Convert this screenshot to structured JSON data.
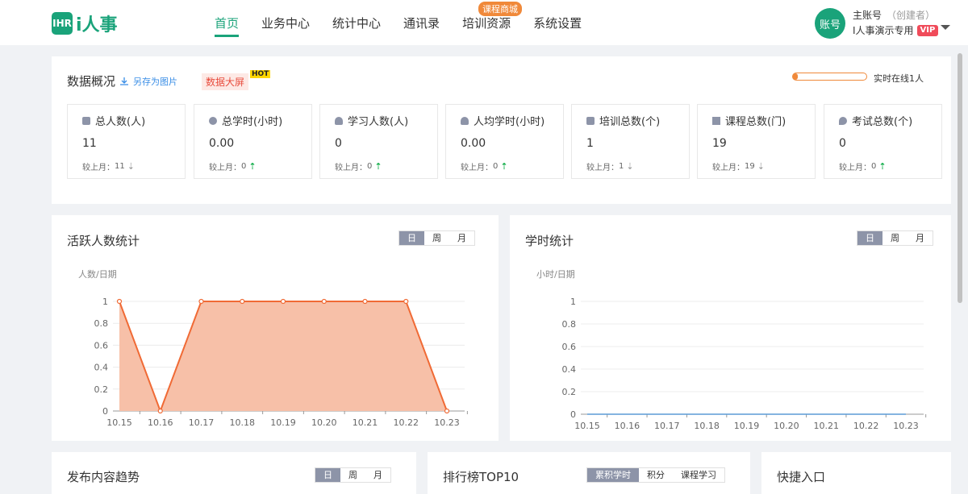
{
  "logo": {
    "box": "IHR",
    "text": "i人事"
  },
  "nav": {
    "items": [
      {
        "label": "首页"
      },
      {
        "label": "业务中心"
      },
      {
        "label": "统计中心"
      },
      {
        "label": "通讯录"
      },
      {
        "label": "培训资源",
        "badge": "课程商城"
      },
      {
        "label": "系统设置"
      }
    ]
  },
  "account": {
    "avatar": "账号",
    "name": "主账号",
    "role": "（创建者）",
    "sub": "I人事演示专用",
    "vip": "VIP"
  },
  "overview": {
    "title": "数据概况",
    "save_link": "另存为图片",
    "bigscreen": "数据大屏",
    "hot": "HOT",
    "online": "实时在线1人",
    "online_fraction": 0.07,
    "stats": [
      {
        "label": "总人数(人)",
        "icon": "building-icon",
        "value": "11",
        "cmp_label": "较上月：",
        "cmp": "11",
        "trend": "down"
      },
      {
        "label": "总学时(小时)",
        "icon": "clock-icon",
        "value": "0.00",
        "cmp_label": "较上月：",
        "cmp": "0",
        "trend": "up"
      },
      {
        "label": "学习人数(人)",
        "icon": "users-icon",
        "value": "0",
        "cmp_label": "较上月：",
        "cmp": "0",
        "trend": "up"
      },
      {
        "label": "人均学时(小时)",
        "icon": "user-clock-icon",
        "value": "0.00",
        "cmp_label": "较上月：",
        "cmp": "0",
        "trend": "up"
      },
      {
        "label": "培训总数(个)",
        "icon": "video-icon",
        "value": "1",
        "cmp_label": "较上月：",
        "cmp": "1",
        "trend": "down"
      },
      {
        "label": "课程总数(门)",
        "icon": "list-icon",
        "value": "19",
        "cmp_label": "较上月：",
        "cmp": "19",
        "trend": "down"
      },
      {
        "label": "考试总数(个)",
        "icon": "location-icon",
        "value": "0",
        "cmp_label": "较上月：",
        "cmp": "0",
        "trend": "up"
      }
    ]
  },
  "active_users": {
    "title": "活跃人数统计",
    "tabs": [
      "日",
      "周",
      "月"
    ],
    "active_tab": 0
  },
  "study_hours": {
    "title": "学时统计",
    "tabs": [
      "日",
      "周",
      "月"
    ],
    "active_tab": 0
  },
  "publish_trend": {
    "title": "发布内容趋势",
    "tabs": [
      "日",
      "周",
      "月"
    ],
    "active_tab": 0
  },
  "ranking": {
    "title": "排行榜TOP10",
    "tabs": [
      "累积学时",
      "积分",
      "课程学习"
    ],
    "active_tab": 0
  },
  "shortcuts": {
    "title": "快捷入口"
  },
  "colors": {
    "brand": "#1aa37a",
    "area_fill": "#f7c0a8",
    "area_line": "#f06a35",
    "line_blue": "#5b9bd5"
  },
  "chart_data": [
    {
      "type": "area",
      "unit_label": "人数/日期",
      "categories": [
        "10.15",
        "10.16",
        "10.17",
        "10.18",
        "10.19",
        "10.20",
        "10.21",
        "10.22",
        "10.23"
      ],
      "values": [
        1,
        0,
        1,
        1,
        1,
        1,
        1,
        1,
        0
      ],
      "yticks": [
        "0",
        "0.2",
        "0.4",
        "0.6",
        "0.8",
        "1"
      ],
      "ylim": [
        0,
        1
      ]
    },
    {
      "type": "line",
      "unit_label": "小时/日期",
      "categories": [
        "10.15",
        "10.16",
        "10.17",
        "10.18",
        "10.19",
        "10.20",
        "10.21",
        "10.22",
        "10.23"
      ],
      "values": [
        0,
        0,
        0,
        0,
        0,
        0,
        0,
        0,
        0
      ],
      "yticks": [
        "0",
        "0.2",
        "0.4",
        "0.6",
        "0.8",
        "1"
      ],
      "ylim": [
        0,
        1
      ]
    }
  ]
}
